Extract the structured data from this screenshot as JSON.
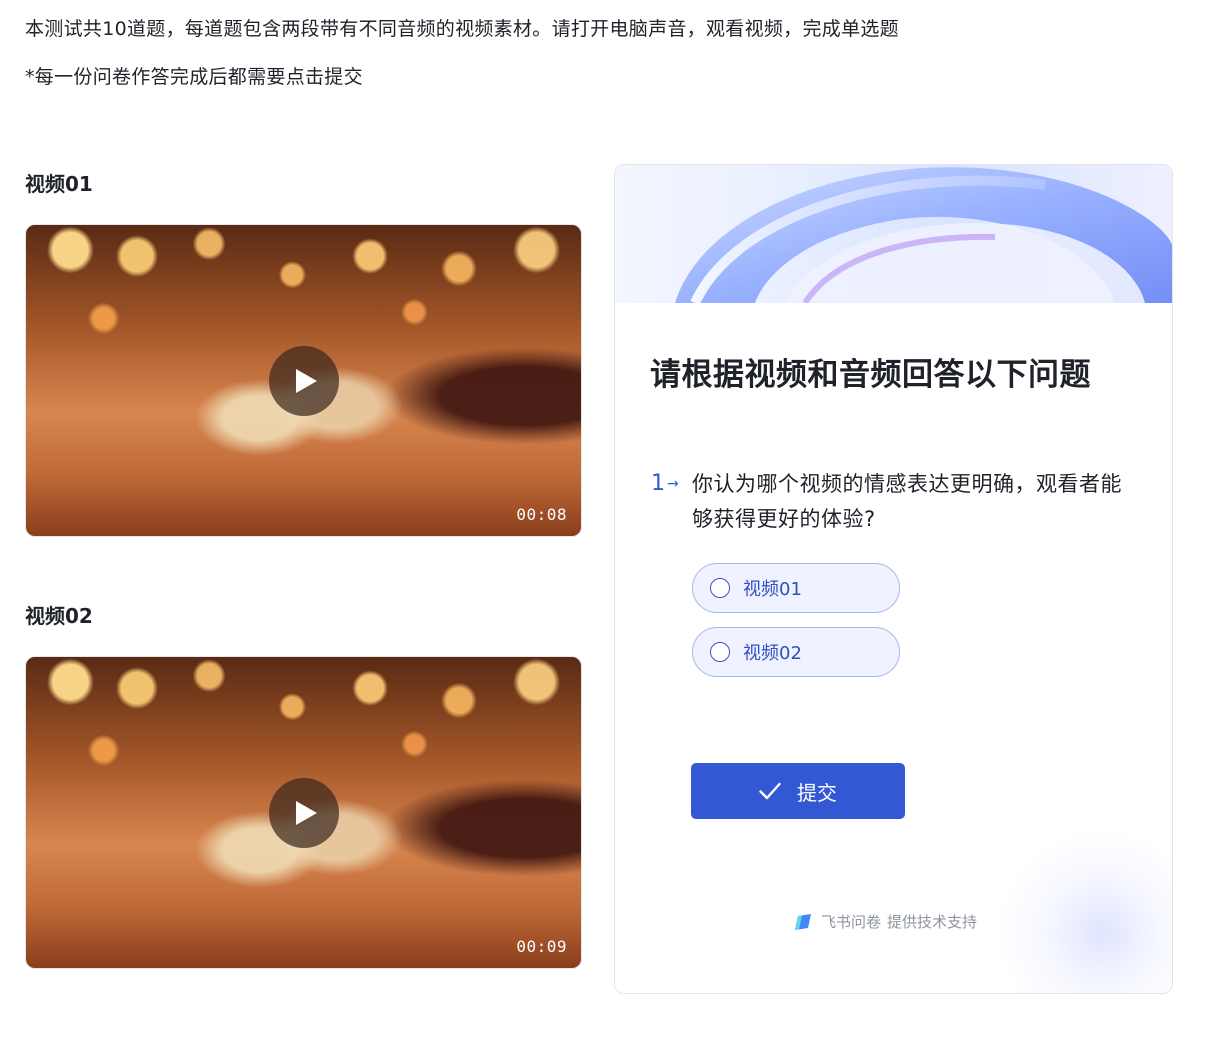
{
  "intro": {
    "line1": "本测试共10道题，每道题包含两段带有不同音频的视频素材。请打开电脑声音，观看视频，完成单选题",
    "line2": "*每一份问卷作答完成后都需要点击提交"
  },
  "videos": [
    {
      "title": "视频01",
      "duration": "00:08",
      "icon": "play-icon"
    },
    {
      "title": "视频02",
      "duration": "00:09",
      "icon": "play-icon"
    }
  ],
  "form": {
    "title": "请根据视频和音频回答以下问题",
    "question": {
      "number": "1",
      "arrow": "→",
      "text": "你认为哪个视频的情感表达更明确，观看者能够获得更好的体验?",
      "options": [
        "视频01",
        "视频02"
      ]
    },
    "submit_label": "提交",
    "footer": {
      "brand": "飞书问卷",
      "suffix": "提供技术支持"
    }
  },
  "colors": {
    "accent": "#3358d4",
    "option_bg": "#f0f3ff",
    "option_border": "#a7b8ec",
    "text": "#1f2329",
    "muted": "#8f959e"
  }
}
